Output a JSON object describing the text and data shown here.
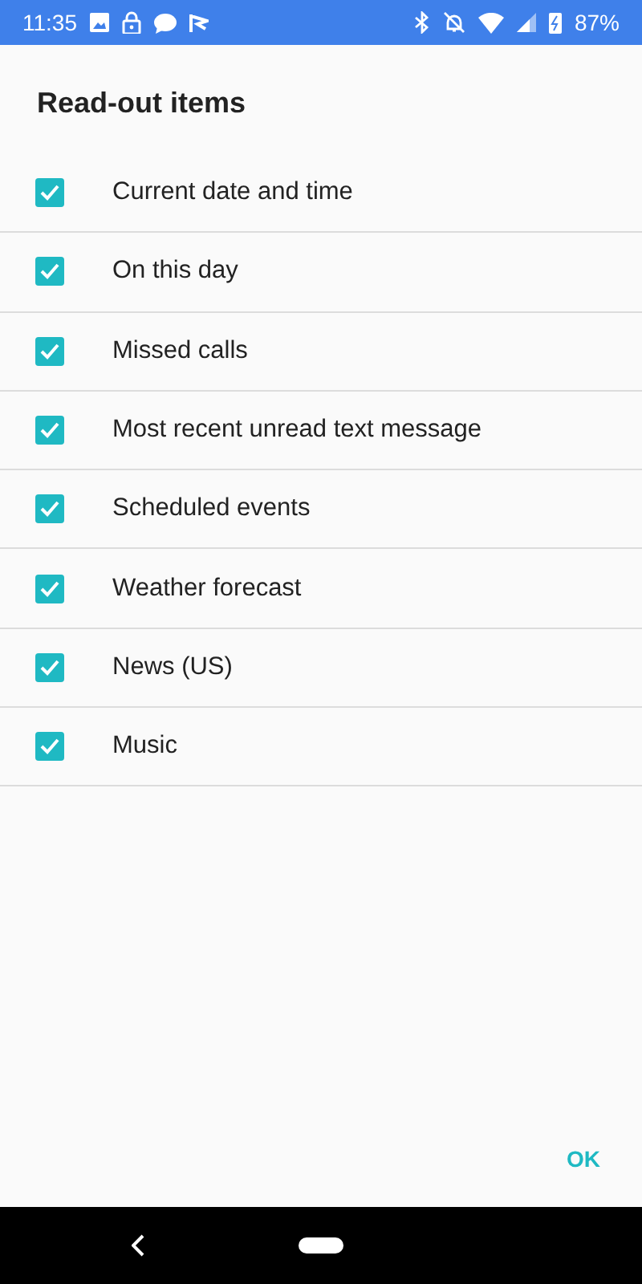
{
  "status_bar": {
    "time": "11:35",
    "battery": "87%"
  },
  "dialog": {
    "title": "Read-out items",
    "items": [
      {
        "label": "Current date and time",
        "checked": true
      },
      {
        "label": "On this day",
        "checked": true
      },
      {
        "label": "Missed calls",
        "checked": true
      },
      {
        "label": "Most recent unread text message",
        "checked": true
      },
      {
        "label": "Scheduled events",
        "checked": true
      },
      {
        "label": "Weather forecast",
        "checked": true
      },
      {
        "label": "News (US)",
        "checked": true
      },
      {
        "label": "Music",
        "checked": true
      }
    ],
    "buttons": [
      "OK"
    ]
  }
}
